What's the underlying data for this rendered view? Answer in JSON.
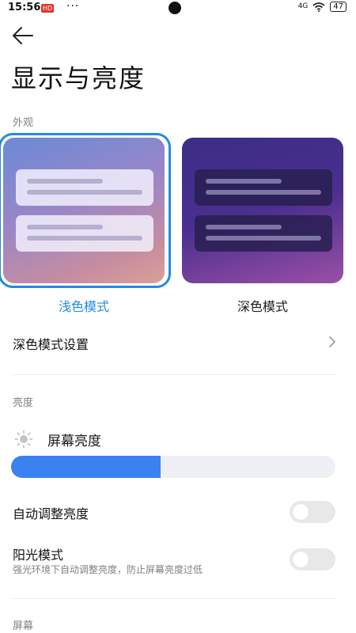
{
  "status_bar": {
    "time": "15:56",
    "badge": "HD",
    "dots": "···",
    "signal": "4G",
    "battery": "47"
  },
  "header": {
    "title": "显示与亮度"
  },
  "appearance": {
    "section_label": "外观",
    "light_label": "浅色模式",
    "dark_label": "深色模式",
    "selected": "light",
    "accent_color": "#1f8be6"
  },
  "dark_settings": {
    "label": "深色模式设置"
  },
  "brightness": {
    "section_label": "亮度",
    "label": "屏幕亮度",
    "level_percent": 46,
    "fill_color": "#3b82f0"
  },
  "auto_brightness": {
    "label": "自动调整亮度",
    "enabled": false
  },
  "sunlight_mode": {
    "label": "阳光模式",
    "description": "强光环境下自动调整亮度，防止屏幕亮度过低",
    "enabled": false
  },
  "screen_section": {
    "label": "屏幕"
  },
  "icons": [
    "back-arrow-icon",
    "sun-icon",
    "chevron-right-icon",
    "wifi-icon",
    "signal-icon",
    "battery-icon",
    "camera-icon"
  ]
}
